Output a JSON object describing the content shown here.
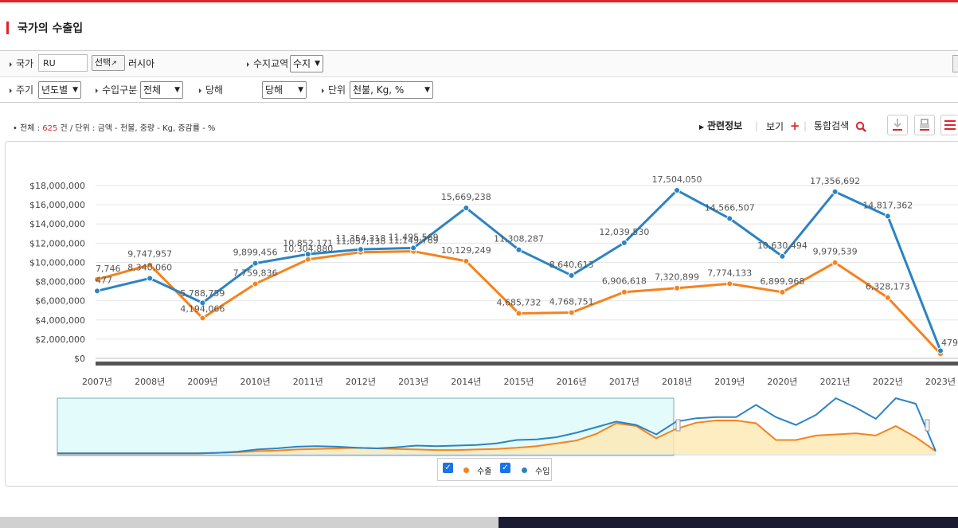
{
  "page": {
    "title": "국가의 수출입"
  },
  "filters": {
    "country_label": "국가",
    "country_code": "RU",
    "select_button": "선택",
    "country_name": "러시아",
    "trade_label": "수지교역",
    "trade_value": "수지",
    "period_label": "주기",
    "period_value": "년도별",
    "import_type_label": "수입구분",
    "import_type_value": "전체",
    "year_label": "당해",
    "year_value": "당해",
    "unit_label": "단위",
    "unit_value": "천불, Kg, %"
  },
  "summary": {
    "total_label": "전체",
    "count": "625",
    "count_unit": "건",
    "unit_desc": "단위 : 금액 - 천불, 중량 - Kg, 증감률 - %"
  },
  "toolbar": {
    "related_info": "관련정보",
    "view_label": "보기",
    "search_label": "통합검색"
  },
  "colors": {
    "export": "#f5821f",
    "import": "#2b83c3",
    "accent": "#e32228"
  },
  "chart_data": {
    "type": "line",
    "categories": [
      "2007년",
      "2008년",
      "2009년",
      "2010년",
      "2011년",
      "2012년",
      "2013년",
      "2014년",
      "2015년",
      "2016년",
      "2017년",
      "2018년",
      "2019년",
      "2020년",
      "2021년",
      "2022년",
      "2023년"
    ],
    "ylim": [
      0,
      18000000
    ],
    "yticks": [
      "$0",
      "$2,000,000",
      "$4,000,000",
      "$6,000,000",
      "$8,000,000",
      "$10,000,000",
      "$12,000,000",
      "$14,000,000",
      "$16,000,000",
      "$18,000,000"
    ],
    "series": [
      {
        "name": "수출",
        "color": "#f5821f",
        "values": [
          8217746,
          9747957,
          4194066,
          7759836,
          10304880,
          11057138,
          11149769,
          10129249,
          4685732,
          4768751,
          6906618,
          7320899,
          7774133,
          6899968,
          9979539,
          6328173,
          479000
        ],
        "labels": [
          "7,746",
          "9,747,957",
          "4,194,066",
          "7,759,836",
          "10,304,880",
          "11,057,138",
          "11,149,769",
          "10,129,249",
          "4,685,732",
          "4,768,751",
          "6,906,618",
          "7,320,899",
          "7,774,133",
          "6,899,968",
          "9,979,539",
          "6,328,173",
          "479"
        ]
      },
      {
        "name": "수입",
        "color": "#2b83c3",
        "values": [
          7024477,
          8340060,
          5788759,
          9899456,
          10852171,
          11354318,
          11495569,
          15669238,
          11308287,
          8640613,
          12039530,
          17504050,
          14566507,
          10630494,
          17356692,
          14817362,
          800000
        ],
        "labels": [
          "477",
          "8,340,060",
          "5,788,759",
          "9,899,456",
          "10,852,171",
          "11,354,318",
          "11,495,569",
          "15,669,238",
          "11,308,287",
          "8,640,613",
          "12,039,530",
          "17,504,050",
          "14,566,507",
          "10,630,494",
          "17,356,692",
          "14,817,362",
          ""
        ]
      }
    ],
    "navigator": {
      "export": [
        0.01,
        0.01,
        0.01,
        0.01,
        0.01,
        0.01,
        0.01,
        0.01,
        0.02,
        0.03,
        0.05,
        0.06,
        0.08,
        0.09,
        0.1,
        0.11,
        0.1,
        0.09,
        0.08,
        0.07,
        0.07,
        0.08,
        0.09,
        0.11,
        0.14,
        0.19,
        0.24,
        0.36,
        0.55,
        0.5,
        0.28,
        0.45,
        0.56,
        0.6,
        0.6,
        0.55,
        0.25,
        0.25,
        0.33,
        0.35,
        0.37,
        0.33,
        0.5,
        0.3,
        0.05
      ],
      "import": [
        0.01,
        0.01,
        0.01,
        0.01,
        0.01,
        0.01,
        0.01,
        0.01,
        0.02,
        0.04,
        0.08,
        0.1,
        0.13,
        0.14,
        0.13,
        0.11,
        0.1,
        0.12,
        0.15,
        0.14,
        0.15,
        0.16,
        0.19,
        0.25,
        0.26,
        0.3,
        0.38,
        0.48,
        0.58,
        0.52,
        0.35,
        0.58,
        0.64,
        0.66,
        0.66,
        0.88,
        0.66,
        0.52,
        0.7,
        1.0,
        0.83,
        0.63,
        1.0,
        0.9,
        0.05
      ]
    }
  },
  "legend": {
    "export": "수출",
    "import": "수입"
  }
}
